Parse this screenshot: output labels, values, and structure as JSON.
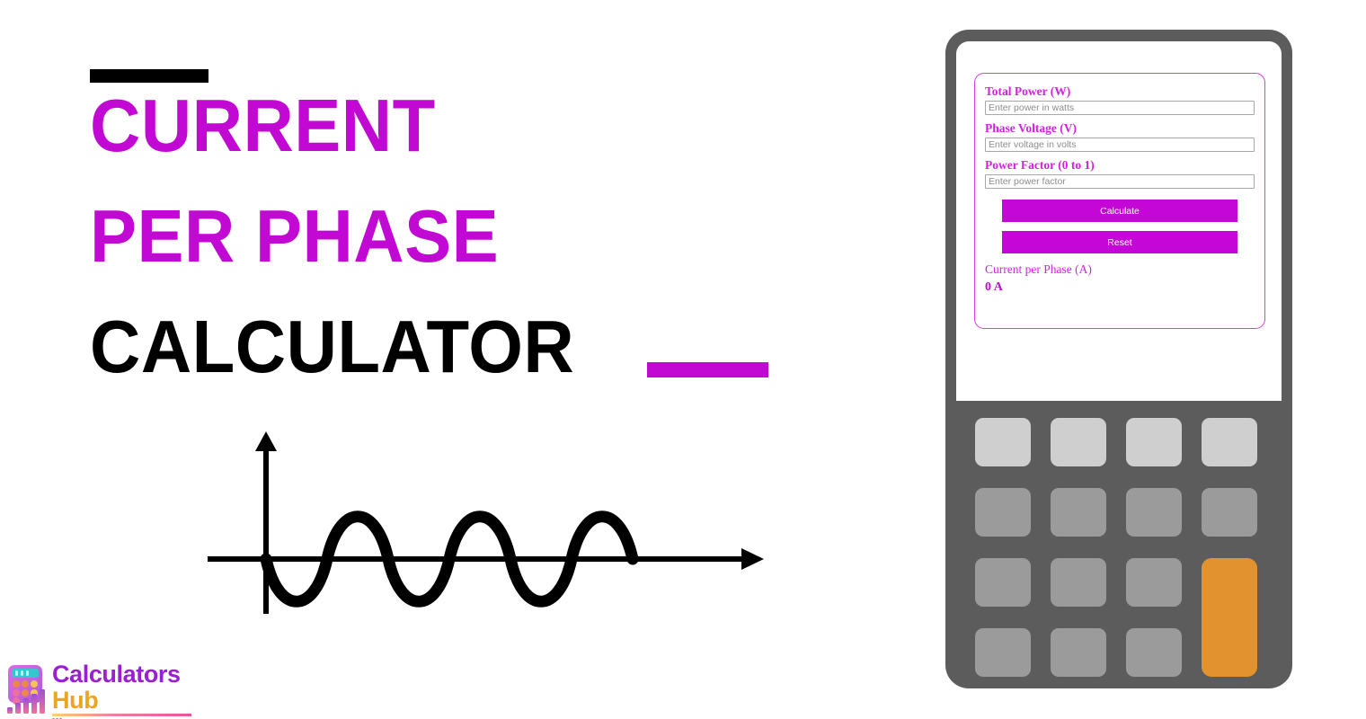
{
  "hero": {
    "title_line_1": "CURRENT",
    "title_line_2": "PER PHASE",
    "title_line_3": "CALCULATOR",
    "accent_color": "#c209d4",
    "dark_color": "#000000"
  },
  "illustration": {
    "name": "sine-wave-graph",
    "description": "AC sine waveform with x and y axes",
    "cycles": 3,
    "stroke_color": "#000000"
  },
  "logo": {
    "name_line_1": "Calculators",
    "name_line_2": "Hub",
    "line_1_color": "#9b1fd0",
    "line_2_color": "#eda421",
    "icon": "calculator-bar-chart-icon"
  },
  "calculator": {
    "body_color": "#5c5c5c",
    "screen_color": "#ffffff",
    "accent_color": "#c406d6",
    "form": {
      "fields": [
        {
          "label": "Total Power (W)",
          "placeholder": "Enter power in watts",
          "value": ""
        },
        {
          "label": "Phase Voltage (V)",
          "placeholder": "Enter voltage in volts",
          "value": ""
        },
        {
          "label": "Power Factor (0 to 1)",
          "placeholder": "Enter power factor",
          "value": ""
        }
      ],
      "calculate_label": "Calculate",
      "reset_label": "Reset",
      "result_label": "Current per Phase (A)",
      "result_value": "0 A"
    },
    "keypad": {
      "rows": 4,
      "columns": 4,
      "light_key_color": "#cfcfcf",
      "key_color": "#9b9b9b",
      "accent_key_color": "#e2922f"
    }
  }
}
